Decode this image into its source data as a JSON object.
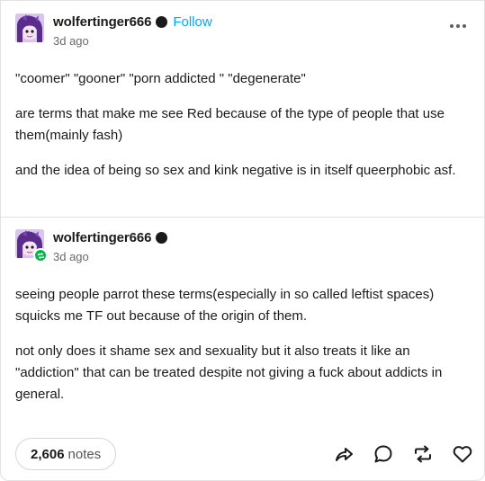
{
  "post": {
    "author": "wolfertinger666",
    "follow_label": "Follow",
    "timestamp": "3d ago",
    "paragraphs": [
      "\"coomer\" \"gooner\" \"porn addicted \" \"degenerate\"",
      "are terms that make me see Red because of the type of people that use them(mainly fash)",
      "and the idea of being so sex and kink negative is in itself queerphobic asf."
    ]
  },
  "reblog": {
    "author": "wolfertinger666",
    "timestamp": "3d ago",
    "paragraphs": [
      "seeing people parrot these terms(especially in so called leftist spaces) squicks me TF out because of the origin of them.",
      "not only does it shame sex and sexuality but it also treats it like an \"addiction\" that can be treated despite not giving a fuck about addicts in general."
    ]
  },
  "footer": {
    "notes_count": "2,606",
    "notes_label": "notes",
    "actions": [
      "share-icon",
      "reply-icon",
      "reblog-icon",
      "like-icon"
    ]
  },
  "colors": {
    "accent_follow": "#00a8ff",
    "reblog_badge": "#00b84a",
    "text": "#1a1a1a",
    "muted": "#6b6b6b"
  }
}
